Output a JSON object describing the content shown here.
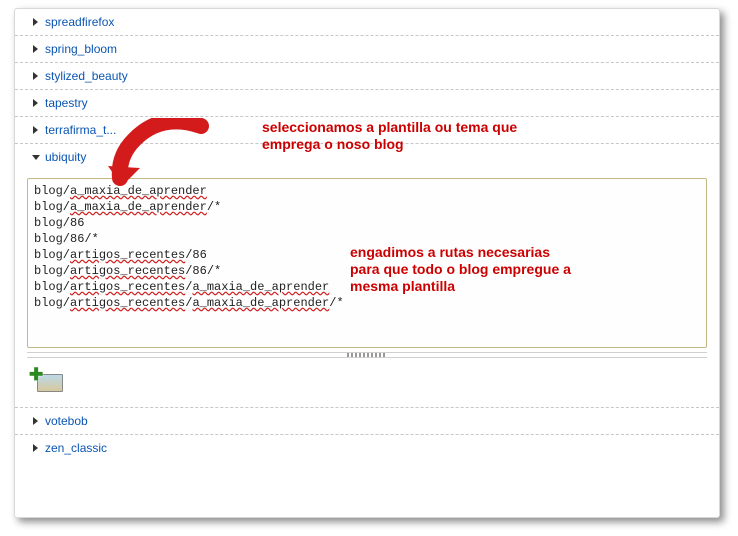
{
  "themes": {
    "collapsed_top": [
      {
        "label": "spreadfirefox"
      },
      {
        "label": "spring_bloom"
      },
      {
        "label": "stylized_beauty"
      },
      {
        "label": "tapestry"
      },
      {
        "label": "terrafirma_t..."
      }
    ],
    "expanded": {
      "label": "ubiquity",
      "textarea_value": "blog/a_maxia_de_aprender\nblog/a_maxia_de_aprender/*\nblog/86\nblog/86/*\nblog/artigos_recentes/86\nblog/artigos_recentes/86/*\nblog/artigos_recentes/a_maxia_de_aprender\nblog/artigos_recentes/a_maxia_de_aprender/*"
    },
    "collapsed_bottom": [
      {
        "label": "votebob"
      },
      {
        "label": "zen_classic"
      }
    ]
  },
  "annotations": {
    "top": "seleccionamos a plantilla ou tema que\nemprega o noso blog",
    "mid": "engadimos a rutas necesarias\npara que todo o blog empregue a\nmesma plantilla"
  }
}
